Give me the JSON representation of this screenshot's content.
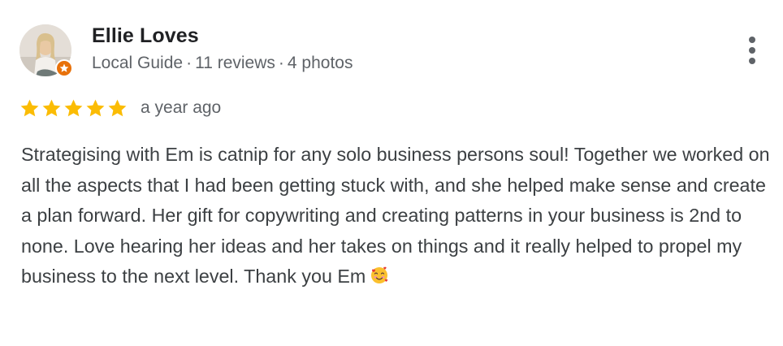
{
  "reviewer": {
    "name": "Ellie Loves",
    "role": "Local Guide",
    "reviews": "11 reviews",
    "photos": "4 photos",
    "separator": "·"
  },
  "rating": {
    "stars": 5,
    "max": 5,
    "date": "a year ago",
    "star_color": "#fbbc04"
  },
  "review": {
    "text": "Strategising with Em is catnip for any solo business persons soul! Together we worked on all the aspects that I had been getting stuck with, and she helped make sense and create a plan forward. Her gift for copywriting and creating patterns in your business is 2nd to none. Love hearing her ideas and her takes on things and it really helped to propel my business to the next level. Thank you Em",
    "emoji_icon": "smiling-face-with-hearts-icon"
  },
  "colors": {
    "name": "#202124",
    "secondary": "#5f6368",
    "body": "#3c4043",
    "badge": "#e8710a"
  }
}
